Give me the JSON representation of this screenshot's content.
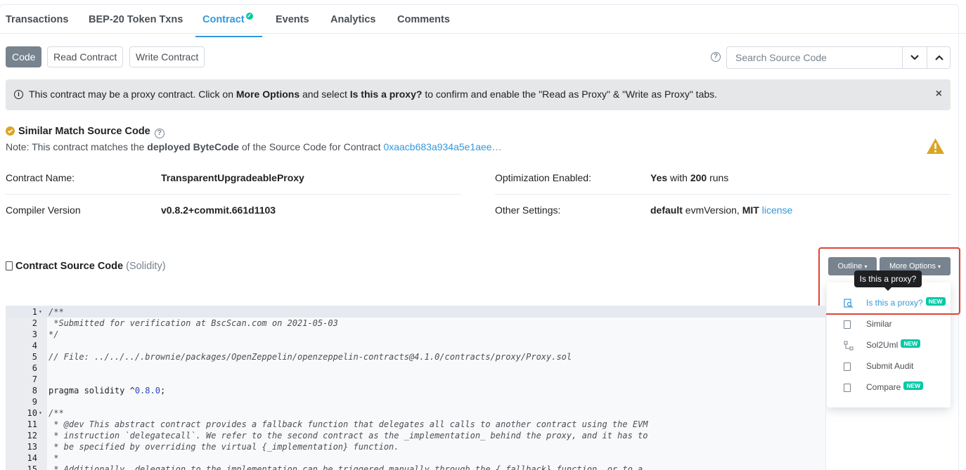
{
  "tabs": [
    {
      "label": "Transactions"
    },
    {
      "label": "BEP-20 Token Txns"
    },
    {
      "label": "Contract"
    },
    {
      "label": "Events"
    },
    {
      "label": "Analytics"
    },
    {
      "label": "Comments"
    }
  ],
  "subnav": {
    "code": "Code",
    "read": "Read Contract",
    "write": "Write Contract"
  },
  "search": {
    "placeholder": "Search Source Code"
  },
  "alert": {
    "part1": "This contract may be a proxy contract. Click on ",
    "bold1": "More Options",
    "part2": " and select ",
    "bold2": "Is this a proxy?",
    "part3": " to confirm and enable the \"Read as Proxy\" & \"Write as Proxy\" tabs."
  },
  "similar": {
    "title": "Similar Match Source Code",
    "note_prefix": "Note: This contract matches the ",
    "note_bold": "deployed ByteCode",
    "note_suffix": " of the Source Code for Contract ",
    "note_link": "0xaacb683a934a5e1aee…"
  },
  "info": {
    "name_label": "Contract Name:",
    "name_value": "TransparentUpgradeableProxy",
    "opt_label": "Optimization Enabled:",
    "opt_yes": "Yes",
    "opt_with": " with ",
    "opt_runs": "200",
    "opt_runs_suffix": " runs",
    "compiler_label": "Compiler Version",
    "compiler_value": "v0.8.2+commit.661d1103",
    "other_label": "Other Settings:",
    "other_default": "default",
    "other_evm": " evmVersion, ",
    "other_mit": "MIT",
    "other_license": " license"
  },
  "source": {
    "title": "Contract Source Code",
    "subtitle": " (Solidity)",
    "outline_label": "Outline",
    "more_options_label": "More Options",
    "tooltip": "Is this a proxy?"
  },
  "dropdown": {
    "items": [
      {
        "label": "Is this a proxy?",
        "badge": "NEW",
        "icon": "search-doc-icon"
      },
      {
        "label": "Similar",
        "badge": "",
        "icon": "file-icon"
      },
      {
        "label": "Sol2Uml",
        "badge": "NEW",
        "icon": "diagram-icon"
      },
      {
        "label": "Submit Audit",
        "badge": "",
        "icon": "file-icon"
      },
      {
        "label": "Compare",
        "badge": "NEW",
        "icon": "file-icon"
      }
    ]
  },
  "code": {
    "lines": [
      {
        "n": "1",
        "fold": "▾",
        "text": "/**",
        "cls": "cm"
      },
      {
        "n": "2",
        "fold": "",
        "text": " *Submitted for verification at BscScan.com on 2021-05-03",
        "cls": "cm"
      },
      {
        "n": "3",
        "fold": "",
        "text": "*/",
        "cls": "cm"
      },
      {
        "n": "4",
        "fold": "",
        "text": "",
        "cls": ""
      },
      {
        "n": "5",
        "fold": "",
        "text": "// File: ../../../.brownie/packages/OpenZeppelin/openzeppelin-contracts@4.1.0/contracts/proxy/Proxy.sol",
        "cls": "cm"
      },
      {
        "n": "6",
        "fold": "",
        "text": "",
        "cls": ""
      },
      {
        "n": "7",
        "fold": "",
        "text": "",
        "cls": ""
      },
      {
        "n": "8",
        "fold": "",
        "text": "pragma solidity ^0.8.0;",
        "cls": ""
      },
      {
        "n": "9",
        "fold": "",
        "text": "",
        "cls": ""
      },
      {
        "n": "10",
        "fold": "▾",
        "text": "/**",
        "cls": "cm"
      },
      {
        "n": "11",
        "fold": "",
        "text": " * @dev This abstract contract provides a fallback function that delegates all calls to another contract using the EVM",
        "cls": "cm"
      },
      {
        "n": "12",
        "fold": "",
        "text": " * instruction `delegatecall`. We refer to the second contract as the _implementation_ behind the proxy, and it has to",
        "cls": "cm"
      },
      {
        "n": "13",
        "fold": "",
        "text": " * be specified by overriding the virtual {_implementation} function.",
        "cls": "cm"
      },
      {
        "n": "14",
        "fold": "",
        "text": " *",
        "cls": "cm"
      },
      {
        "n": "15",
        "fold": "",
        "text": " * Additionally, delegation to the implementation can be triggered manually through the {_fallback} function, or to a",
        "cls": "cm"
      }
    ]
  }
}
